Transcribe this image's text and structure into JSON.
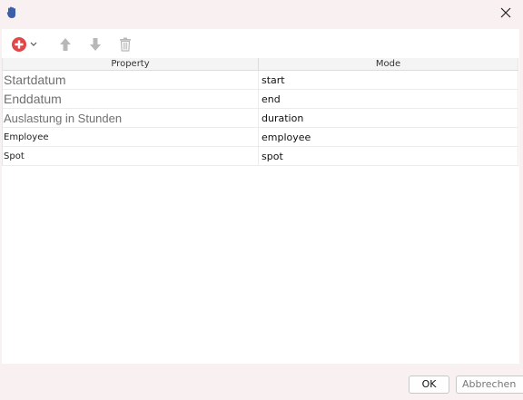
{
  "window": {
    "close_icon": "close-icon",
    "app_icon": "hand-icon"
  },
  "toolbar": {
    "add_icon": "add-circle-icon",
    "dropdown_icon": "chevron-down-icon",
    "up_icon": "arrow-up-icon",
    "down_icon": "arrow-down-icon",
    "delete_icon": "trash-icon",
    "add_color": "#e04848",
    "disabled_color": "#b8b8b8"
  },
  "grid": {
    "columns": [
      "Property",
      "Mode"
    ],
    "rows": [
      {
        "property": "Startdatum",
        "mode": "start"
      },
      {
        "property": "Enddatum",
        "mode": "end"
      },
      {
        "property": "Auslastung in Stunden",
        "mode": "duration"
      },
      {
        "property": "Employee",
        "mode": "employee"
      },
      {
        "property": "Spot",
        "mode": "spot"
      }
    ]
  },
  "buttons": {
    "ok": "OK",
    "cancel": "Abbrechen"
  }
}
